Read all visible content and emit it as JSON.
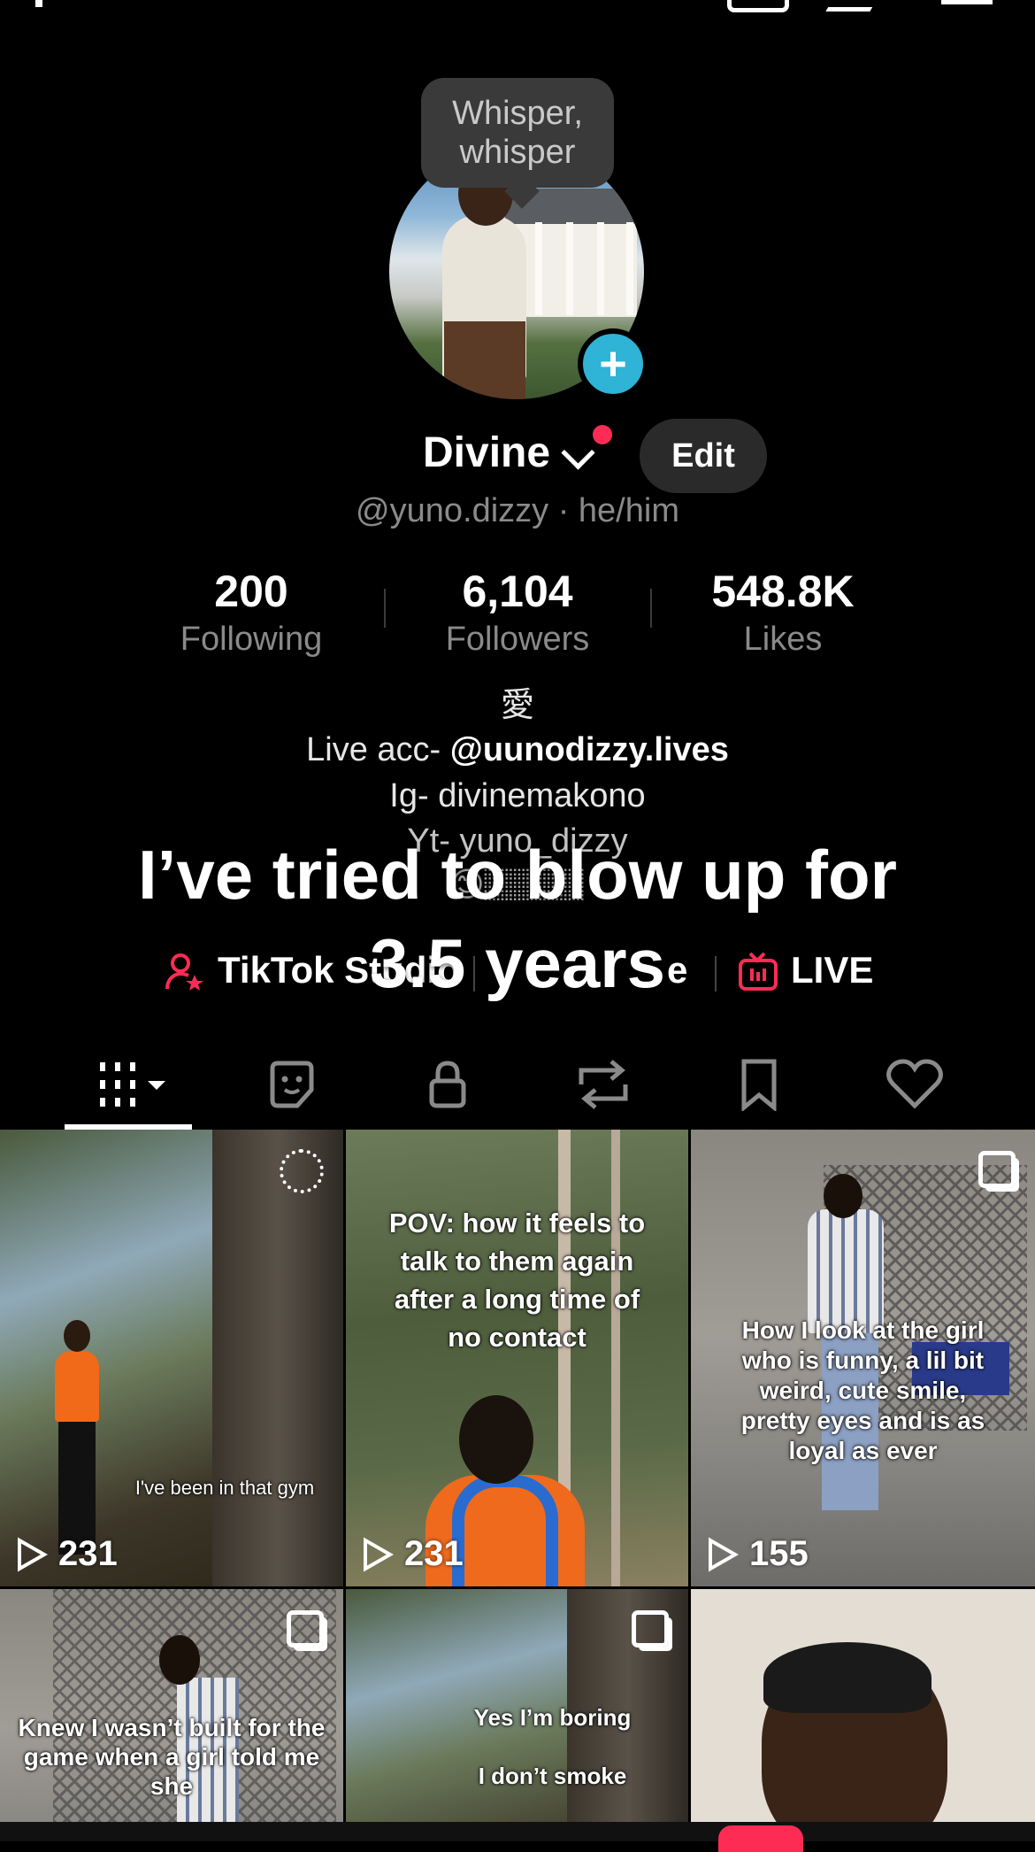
{
  "header": {
    "bubble": [
      "Whisper,",
      "whisper"
    ]
  },
  "profile": {
    "name": "Divine",
    "edit_label": "Edit",
    "handle_line": "@yuno.dizzy · he/him"
  },
  "stats": [
    {
      "value": "200",
      "label": "Following"
    },
    {
      "value": "6,104",
      "label": "Followers"
    },
    {
      "value": "548.8K",
      "label": "Likes"
    }
  ],
  "bio": {
    "line1": "愛",
    "line2_prefix": "Live acc- ",
    "line2_link": "@uunodizzy.lives",
    "line3": "Ig- divinemakono",
    "line4": "Yt- yuno_dizzy",
    "line5": "😊🏽🏽🏽"
  },
  "overlay": {
    "line1": "I’ve tried to blow up for",
    "line2": "3.5 years"
  },
  "links": {
    "studio": "TikTok Studio",
    "mid": "e",
    "live": "LIVE"
  },
  "colors": {
    "accent_red": "#fe2c55",
    "accent_blue": "#2fb3d6"
  },
  "tabs": [
    "videos-grid-icon",
    "sticker-icon",
    "lock-icon",
    "repost-icon",
    "bookmark-icon",
    "heart-icon"
  ],
  "videos": [
    {
      "caption": "I've been in that gym",
      "views": "231"
    },
    {
      "caption": "POV: how it feels to talk to them again after a long time of no contact",
      "views": "231"
    },
    {
      "caption": "How I look at the girl who is funny, a lil bit weird, cute smile, pretty eyes and is as loyal as ever",
      "views": "155"
    },
    {
      "caption": "Knew I wasn’t built for the game when a girl told me she"
    },
    {
      "caption": "Yes I’m boring\nI don’t smoke\nI don’t drink"
    },
    {
      "caption": ""
    }
  ]
}
